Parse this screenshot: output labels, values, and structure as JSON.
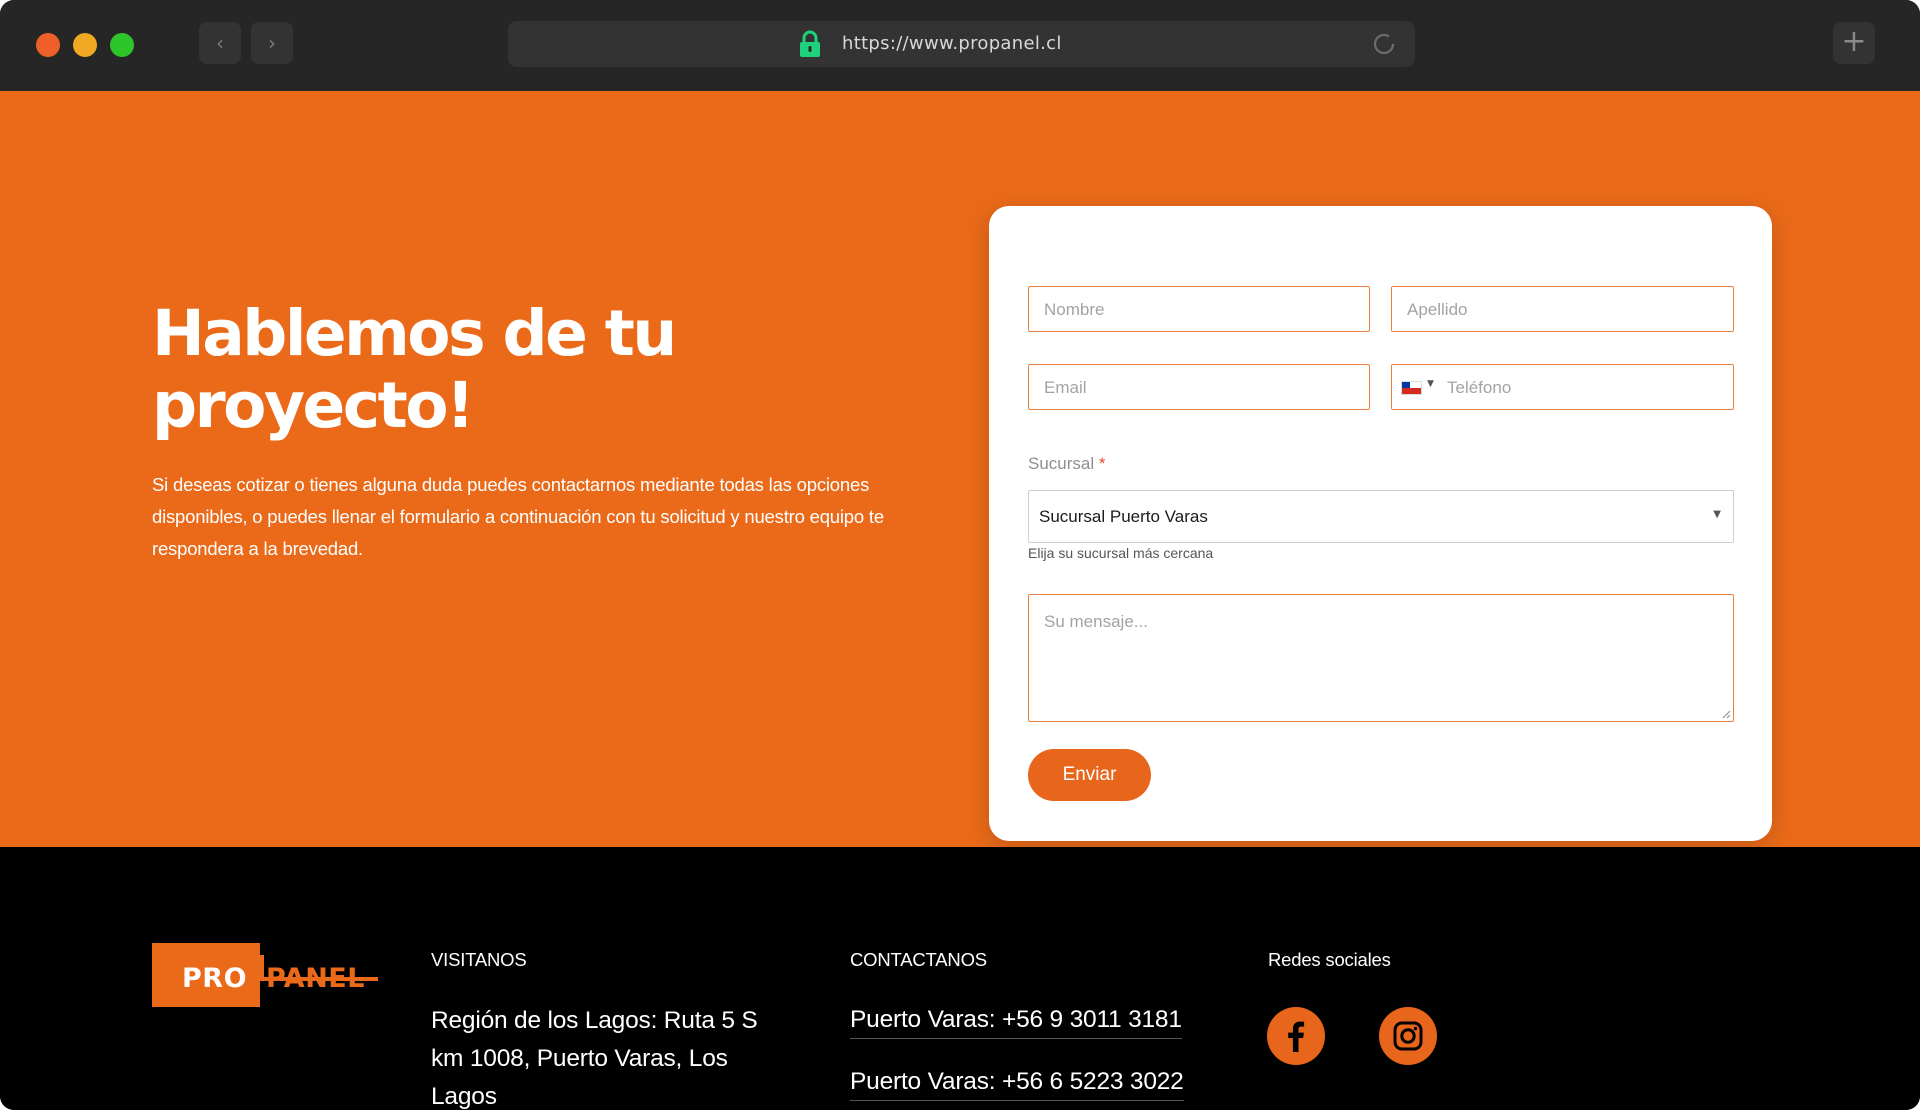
{
  "browser": {
    "url": "https://www.propanel.cl",
    "back_icon": "chevron-left-icon",
    "forward_icon": "chevron-right-icon",
    "new_tab_icon": "plus-icon"
  },
  "hero": {
    "title": "Hablemos de tu proyecto!",
    "description": "Si deseas cotizar o tienes alguna duda puedes contactarnos mediante todas las opciones disponibles, o puedes llenar el formulario a continuación con tu solicitud y nuestro equipo te respondera a la brevedad."
  },
  "form": {
    "nombre_placeholder": "Nombre",
    "apellido_placeholder": "Apellido",
    "email_placeholder": "Email",
    "telefono_placeholder": "Teléfono",
    "phone_country": "Chile",
    "sucursal_label": "Sucursal",
    "required_mark": "*",
    "sucursal_value": "Sucursal Puerto Varas",
    "sucursal_hint": "Elija su sucursal más cercana",
    "message_placeholder": "Su mensaje...",
    "submit_label": "Enviar"
  },
  "footer": {
    "logo_text_pro": "PRO",
    "logo_text_panel": "PANEL",
    "visit_title": "VISITANOS",
    "address": "Región de los Lagos: Ruta 5 S km 1008, Puerto Varas, Los Lagos",
    "contact_title": "CONTACTANOS",
    "phones": [
      "Puerto Varas: +56 9 3011 3181",
      "Puerto Varas: +56 6 5223 3022"
    ],
    "social_title": "Redes sociales",
    "social": [
      "facebook-icon",
      "instagram-icon"
    ]
  },
  "colors": {
    "brand_orange": "#eb6a19",
    "button_orange": "#e8661c",
    "footer_bg": "#000000",
    "chrome_bg": "#262626"
  }
}
